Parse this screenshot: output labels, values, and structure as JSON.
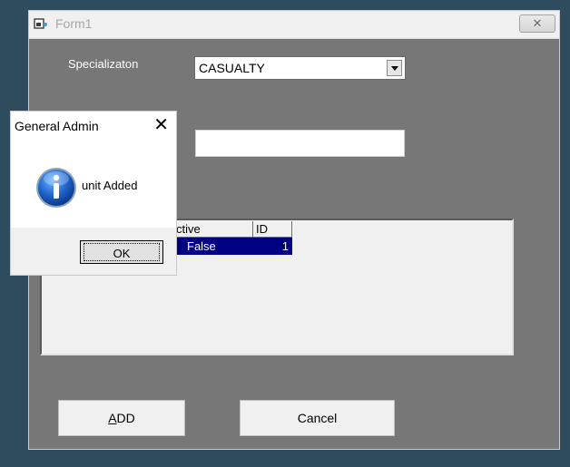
{
  "window": {
    "title": "Form1",
    "close_glyph": "✕"
  },
  "form": {
    "specialization_label": "Specializaton",
    "specialization_value": "CASUALTY",
    "unit_value": ""
  },
  "grid": {
    "columns": [
      "ctive",
      "ID"
    ],
    "rows": [
      {
        "active": "False",
        "id": "1"
      }
    ]
  },
  "buttons": {
    "add_mnemonic": "A",
    "add_rest": "DD",
    "cancel": "Cancel"
  },
  "dialog": {
    "title": "General Admin",
    "close_glyph": "✕",
    "message": "unit Added",
    "ok": "OK",
    "icon": "info-icon"
  },
  "colors": {
    "desktop": "#2f4c5f",
    "form_bg": "#777777",
    "selection": "#000080"
  }
}
